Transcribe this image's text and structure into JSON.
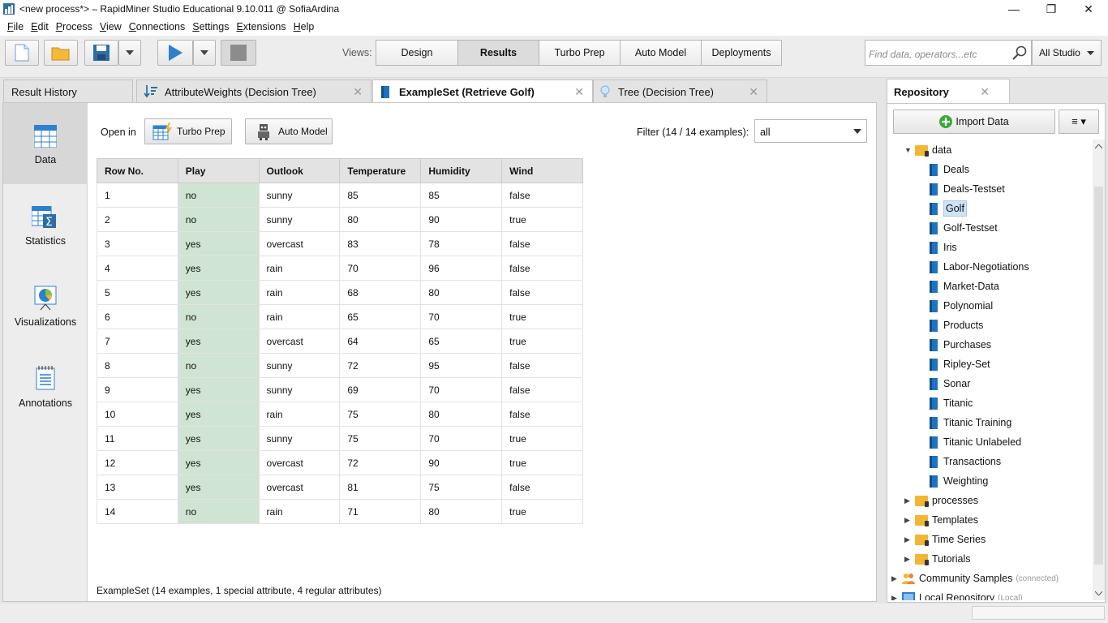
{
  "window": {
    "title": "<new process*> – RapidMiner Studio Educational 9.10.011 @ SofiaArdina",
    "minimize": "—",
    "maximize": "❐",
    "close": "✕"
  },
  "menu": [
    "File",
    "Edit",
    "Process",
    "View",
    "Connections",
    "Settings",
    "Extensions",
    "Help"
  ],
  "toolbar": {
    "views_label": "Views:",
    "views": [
      "Design",
      "Results",
      "Turbo Prep",
      "Auto Model",
      "Deployments"
    ],
    "active_view": "Results",
    "search_placeholder": "Find data, operators...etc",
    "scope": "All Studio"
  },
  "tabs": [
    {
      "label": "Result History"
    },
    {
      "label": "AttributeWeights (Decision Tree)"
    },
    {
      "label": "ExampleSet (Retrieve Golf)"
    },
    {
      "label": "Tree (Decision Tree)"
    }
  ],
  "tab_close": "✕",
  "sidenav": [
    "Data",
    "Statistics",
    "Visualizations",
    "Annotations"
  ],
  "data_view": {
    "open_in": "Open in",
    "turbo_prep": "Turbo Prep",
    "auto_model": "Auto Model",
    "filter_label": "Filter (14 / 14 examples):",
    "filter_value": "all",
    "footer": "ExampleSet (14 examples, 1 special attribute, 4 regular attributes)"
  },
  "table": {
    "columns": [
      "Row No.",
      "Play",
      "Outlook",
      "Temperature",
      "Humidity",
      "Wind"
    ],
    "rows": [
      [
        "1",
        "no",
        "sunny",
        "85",
        "85",
        "false"
      ],
      [
        "2",
        "no",
        "sunny",
        "80",
        "90",
        "true"
      ],
      [
        "3",
        "yes",
        "overcast",
        "83",
        "78",
        "false"
      ],
      [
        "4",
        "yes",
        "rain",
        "70",
        "96",
        "false"
      ],
      [
        "5",
        "yes",
        "rain",
        "68",
        "80",
        "false"
      ],
      [
        "6",
        "no",
        "rain",
        "65",
        "70",
        "true"
      ],
      [
        "7",
        "yes",
        "overcast",
        "64",
        "65",
        "true"
      ],
      [
        "8",
        "no",
        "sunny",
        "72",
        "95",
        "false"
      ],
      [
        "9",
        "yes",
        "sunny",
        "69",
        "70",
        "false"
      ],
      [
        "10",
        "yes",
        "rain",
        "75",
        "80",
        "false"
      ],
      [
        "11",
        "yes",
        "sunny",
        "75",
        "70",
        "true"
      ],
      [
        "12",
        "yes",
        "overcast",
        "72",
        "90",
        "true"
      ],
      [
        "13",
        "yes",
        "overcast",
        "81",
        "75",
        "false"
      ],
      [
        "14",
        "no",
        "rain",
        "71",
        "80",
        "true"
      ]
    ]
  },
  "repository": {
    "title": "Repository",
    "import_button": "Import Data",
    "menu_button": "≡ ▾",
    "root": "data",
    "data_items": [
      "Deals",
      "Deals-Testset",
      "Golf",
      "Golf-Testset",
      "Iris",
      "Labor-Negotiations",
      "Market-Data",
      "Polynomial",
      "Products",
      "Purchases",
      "Ripley-Set",
      "Sonar",
      "Titanic",
      "Titanic Training",
      "Titanic Unlabeled",
      "Transactions",
      "Weighting"
    ],
    "selected": "Golf",
    "folders": [
      "processes",
      "Templates",
      "Time Series",
      "Tutorials"
    ],
    "community": {
      "label": "Community Samples",
      "status": "(connected)"
    },
    "local": {
      "label": "Local Repository",
      "status": "(Local)"
    }
  }
}
